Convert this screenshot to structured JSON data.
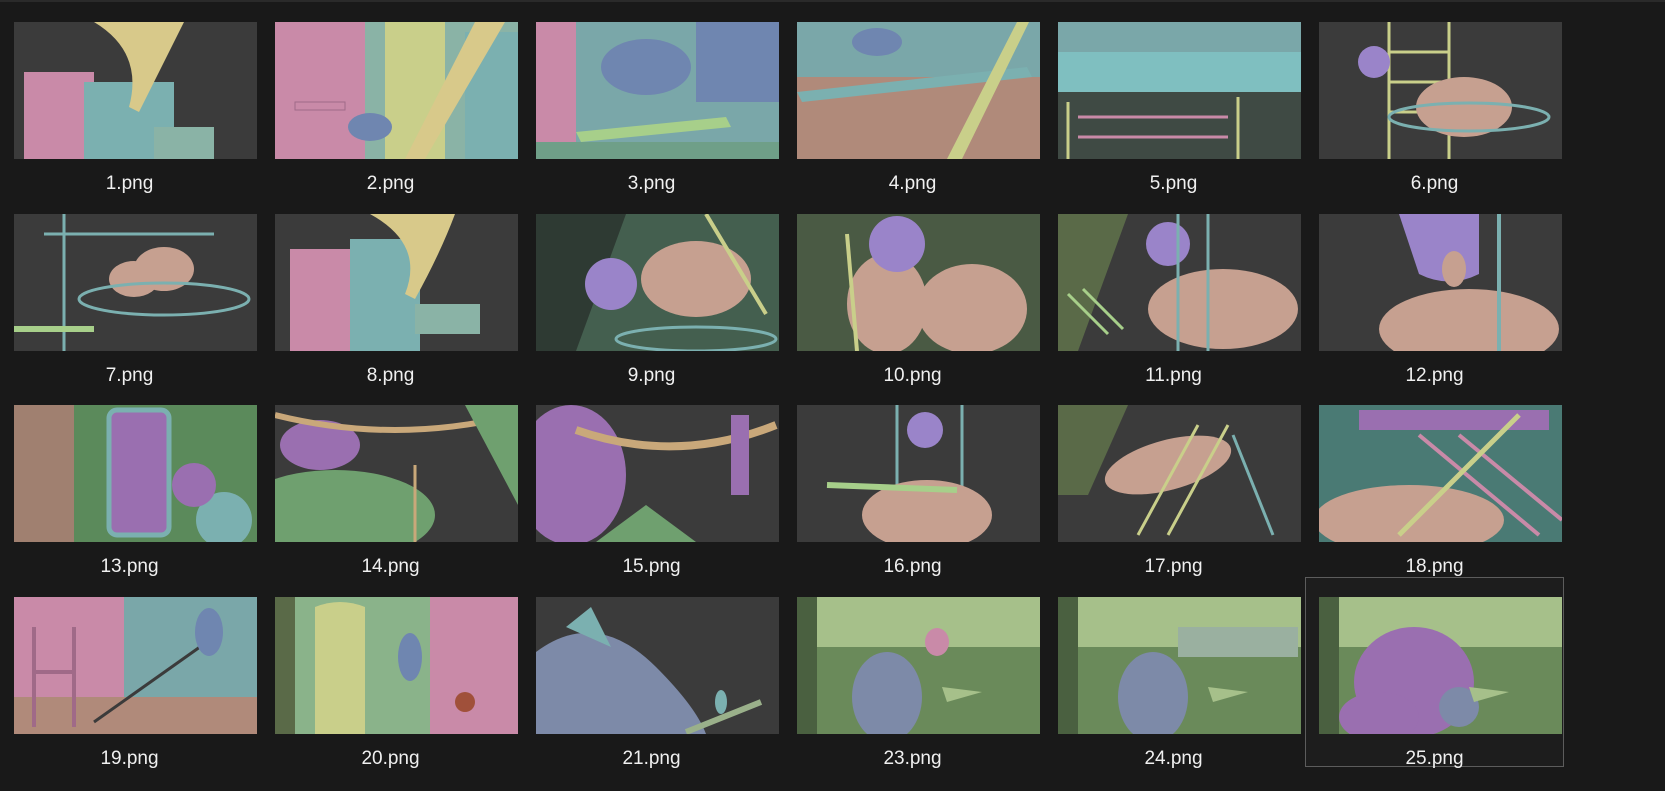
{
  "explorer": {
    "items": [
      {
        "name": "1.png",
        "palette": [
          "#3b3b3b",
          "#d8c98a",
          "#c98aa8",
          "#7bb0b0"
        ]
      },
      {
        "name": "2.png",
        "palette": [
          "#8ab3a6",
          "#c9cf8a",
          "#c98aa8",
          "#6f86b0"
        ]
      },
      {
        "name": "3.png",
        "palette": [
          "#7aa7a9",
          "#6f86b0",
          "#c98aa8",
          "#a7cf8a"
        ]
      },
      {
        "name": "4.png",
        "palette": [
          "#b08a7a",
          "#7bb0b0",
          "#c9cf8a",
          "#6f86b0"
        ]
      },
      {
        "name": "5.png",
        "palette": [
          "#7fbfc0",
          "#3f4a44",
          "#c9cf8a",
          "#c98aa8"
        ]
      },
      {
        "name": "6.png",
        "palette": [
          "#3b3b3b",
          "#c6a090",
          "#c9cf8a",
          "#9a84c9"
        ]
      },
      {
        "name": "7.png",
        "palette": [
          "#3b3b3b",
          "#c6a090",
          "#7bb0b0",
          "#c9cf8a"
        ]
      },
      {
        "name": "8.png",
        "palette": [
          "#3b3b3b",
          "#c98aa8",
          "#d8c98a",
          "#7bb0b0"
        ]
      },
      {
        "name": "9.png",
        "palette": [
          "#445f4f",
          "#c6a090",
          "#9a84c9",
          "#c9cf8a"
        ]
      },
      {
        "name": "10.png",
        "palette": [
          "#4a5a44",
          "#c6a090",
          "#9a84c9",
          "#c9cf8a"
        ]
      },
      {
        "name": "11.png",
        "palette": [
          "#3b3b3b",
          "#c6a090",
          "#9a84c9",
          "#a7cf8a"
        ]
      },
      {
        "name": "12.png",
        "palette": [
          "#3b3b3b",
          "#c6a090",
          "#9a84c9",
          "#7bb0b0"
        ]
      },
      {
        "name": "13.png",
        "palette": [
          "#5b8a5b",
          "#9a6fb0",
          "#7bb0b0",
          "#a08070"
        ]
      },
      {
        "name": "14.png",
        "palette": [
          "#3b3b3b",
          "#6fa06f",
          "#9a6fb0",
          "#c9a87a"
        ]
      },
      {
        "name": "15.png",
        "palette": [
          "#3b3b3b",
          "#9a6fb0",
          "#6fa06f",
          "#c9a87a"
        ]
      },
      {
        "name": "16.png",
        "palette": [
          "#3b3b3b",
          "#c6a090",
          "#9a84c9",
          "#7bb0b0"
        ]
      },
      {
        "name": "17.png",
        "palette": [
          "#3b3b3b",
          "#c6a090",
          "#c9cf8a",
          "#7bb0b0"
        ]
      },
      {
        "name": "18.png",
        "palette": [
          "#4a7a74",
          "#c6a090",
          "#c98aa8",
          "#c9cf8a"
        ]
      },
      {
        "name": "19.png",
        "palette": [
          "#7aa7a9",
          "#c98aa8",
          "#6f86b0",
          "#b08a7a"
        ]
      },
      {
        "name": "20.png",
        "palette": [
          "#8ab38a",
          "#c98aa8",
          "#c9cf8a",
          "#6f86b0"
        ]
      },
      {
        "name": "21.png",
        "palette": [
          "#3b3b3b",
          "#7d8aa8",
          "#7bb0b0",
          "#9ab08a"
        ]
      },
      {
        "name": "23.png",
        "palette": [
          "#6a8a5a",
          "#7d8aa8",
          "#c98aa8",
          "#a6c08a"
        ]
      },
      {
        "name": "24.png",
        "palette": [
          "#6a8a5a",
          "#7d8aa8",
          "#c98aa8",
          "#a6c08a"
        ]
      },
      {
        "name": "25.png",
        "palette": [
          "#6a8a5a",
          "#9a6fb0",
          "#7d8aa8",
          "#a6c08a"
        ],
        "selected": true
      }
    ]
  }
}
